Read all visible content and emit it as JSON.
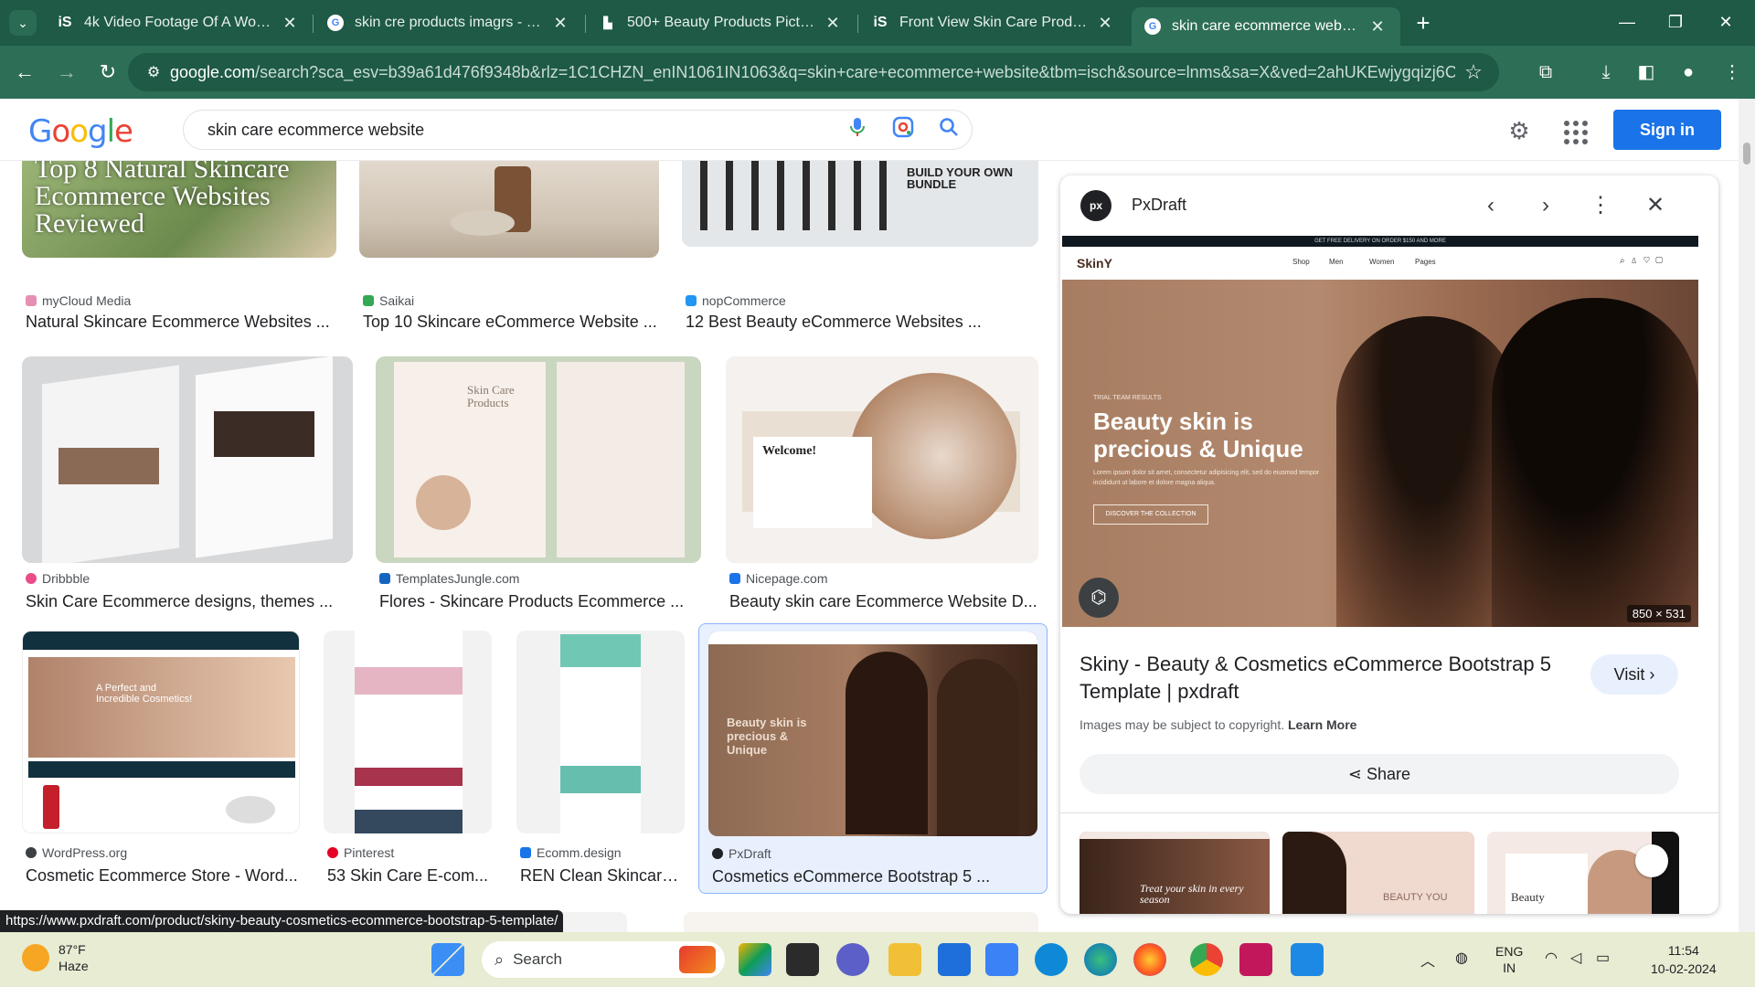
{
  "browser": {
    "tabs": [
      {
        "title": "4k Video Footage Of A Woman",
        "favicon": "istock-icon"
      },
      {
        "title": "skin cre products imagrs - Goo",
        "favicon": "google-icon"
      },
      {
        "title": "500+ Beauty Products Pictures |",
        "favicon": "unsplash-icon"
      },
      {
        "title": "Front View Skin Care Products C",
        "favicon": "istock-icon"
      },
      {
        "title": "skin care ecommerce website -",
        "favicon": "google-icon"
      }
    ],
    "url_host": "google.com",
    "url_path": "/search?sca_esv=b39a61d476f9348b&rlz=1C1CHZN_enIN1061IN1063&q=skin+care+ecommerce+website&tbm=isch&source=lnms&sa=X&ved=2ahUKEwjygqizj6CEAx..."
  },
  "google": {
    "logo": [
      "G",
      "o",
      "o",
      "g",
      "l",
      "e"
    ],
    "query": "skin care ecommerce website",
    "signin": "Sign in"
  },
  "results": [
    {
      "source": "myCloud Media",
      "caption": "Natural Skincare Ecommerce Websites ...",
      "overlay": "Top 8 Natural Skincare Ecommerce Websites Reviewed"
    },
    {
      "source": "Saikai",
      "caption": "Top 10 Skincare eCommerce Website ..."
    },
    {
      "source": "nopCommerce",
      "caption": "12 Best Beauty eCommerce Websites ...",
      "overlay": "BUILD YOUR OWN BUNDLE"
    },
    {
      "source": "Dribbble",
      "caption": "Skin Care Ecommerce designs, themes ..."
    },
    {
      "source": "TemplatesJungle.com",
      "caption": "Flores - Skincare Products Ecommerce ...",
      "overlay": "Skin Care Products"
    },
    {
      "source": "Nicepage.com",
      "caption": "Beauty skin care Ecommerce Website D...",
      "overlay": "Welcome!"
    },
    {
      "source": "WordPress.org",
      "caption": "Cosmetic Ecommerce Store - Word...",
      "overlay": "A Perfect and Incredible Cosmetics!"
    },
    {
      "source": "Pinterest",
      "caption": "53 Skin Care E-com..."
    },
    {
      "source": "Ecomm.design",
      "caption": "REN Clean Skincare ..."
    },
    {
      "source": "PxDraft",
      "caption": "Cosmetics eCommerce Bootstrap 5 ...",
      "overlay": "Beauty skin is precious & Unique"
    }
  ],
  "panel": {
    "source": "PxDraft",
    "logo_text": "px",
    "title": "Skiny - Beauty & Cosmetics eCommerce Bootstrap 5 Template | pxdraft",
    "visit": "Visit",
    "copyright": "Images may be subject to copyright.",
    "learn_more": "Learn More",
    "share": "Share",
    "dimensions": "850 × 531",
    "preview": {
      "banner": "GET FREE DELIVERY ON ORDER $150 AND MORE",
      "brand": "SkinY",
      "nav": [
        "Shop",
        "Men",
        "Women",
        "Pages"
      ],
      "eyebrow": "TRIAL TEAM RESULTS",
      "headline_1": "Beauty skin is",
      "headline_2": "precious & Unique",
      "body": "Lorem ipsum dolor sit amet, consectetur adipisicing elit, sed do eiusmod tempor incididunt ut labore et dolore magna aliqua.",
      "cta": "DISCOVER THE COLLECTION"
    },
    "related_1": "Treat your skin in every season",
    "related_2": "BEAUTY YOU",
    "related_3": "Beauty"
  },
  "status_url": "https://www.pxdraft.com/product/skiny-beauty-cosmetics-ecommerce-bootstrap-5-template/",
  "taskbar": {
    "temp": "87°F",
    "condition": "Haze",
    "search": "Search",
    "lang_1": "ENG",
    "lang_2": "IN",
    "time": "11:54",
    "date": "10-02-2024"
  }
}
